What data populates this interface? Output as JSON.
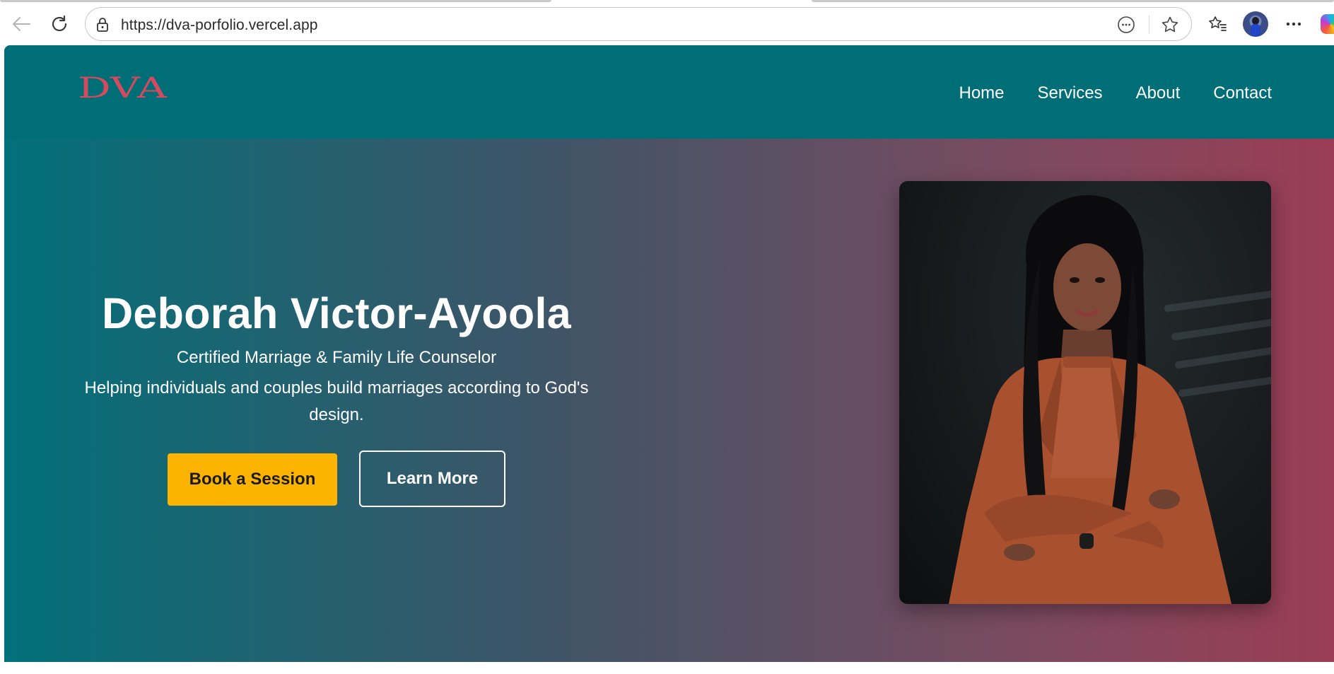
{
  "browser": {
    "url": "https://dva-porfolio.vercel.app"
  },
  "site": {
    "logo_text": "DVA",
    "nav": [
      {
        "label": "Home"
      },
      {
        "label": "Services"
      },
      {
        "label": "About"
      },
      {
        "label": "Contact"
      }
    ],
    "colors": {
      "nav_bg": "#006e76",
      "logo": "#d44a5e",
      "primary_button": "#fdb400",
      "gradient_start": "#02707a",
      "gradient_end": "#9a3d55"
    }
  },
  "hero": {
    "title": "Deborah Victor-Ayoola",
    "subtitle": "Certified Marriage & Family Life Counselor",
    "tagline": "Helping individuals and couples build marriages according to God's design.",
    "primary_button": "Book a Session",
    "secondary_button": "Learn More",
    "image": "portrait-photo"
  }
}
